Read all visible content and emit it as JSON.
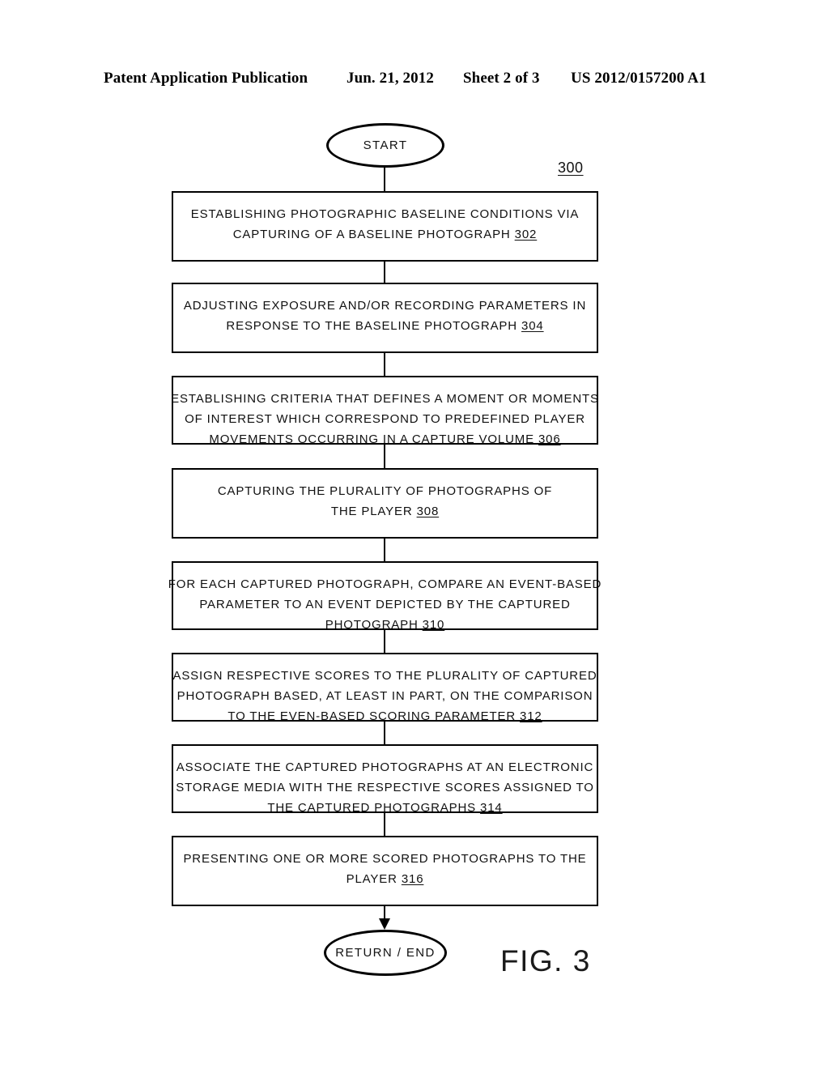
{
  "header": {
    "title": "Patent Application Publication",
    "date": "Jun. 21, 2012",
    "sheet": "Sheet 2 of 3",
    "publication_number": "US 2012/0157200 A1"
  },
  "figure": {
    "caption": "FIG. 3",
    "diagram_reference": "300"
  },
  "flowchart": {
    "start_label": "START",
    "end_label": "RETURN / END",
    "steps": [
      {
        "ref": "302",
        "lines": [
          "ESTABLISHING PHOTOGRAPHIC BASELINE CONDITIONS VIA",
          "CAPTURING OF A BASELINE PHOTOGRAPH"
        ]
      },
      {
        "ref": "304",
        "lines": [
          "ADJUSTING EXPOSURE AND/OR RECORDING PARAMETERS IN",
          "RESPONSE TO THE BASELINE PHOTOGRAPH"
        ]
      },
      {
        "ref": "306",
        "lines": [
          "ESTABLISHING CRITERIA THAT DEFINES A MOMENT OR MOMENTS",
          "OF INTEREST WHICH CORRESPOND TO PREDEFINED PLAYER",
          "MOVEMENTS OCCURRING IN A CAPTURE VOLUME"
        ]
      },
      {
        "ref": "308",
        "lines": [
          "CAPTURING THE PLURALITY OF PHOTOGRAPHS OF",
          "THE PLAYER"
        ]
      },
      {
        "ref": "310",
        "lines": [
          "FOR EACH CAPTURED PHOTOGRAPH, COMPARE AN EVENT-BASED",
          "PARAMETER TO AN EVENT DEPICTED BY THE CAPTURED",
          "PHOTOGRAPH"
        ]
      },
      {
        "ref": "312",
        "lines": [
          "ASSIGN RESPECTIVE SCORES TO THE PLURALITY OF CAPTURED",
          "PHOTOGRAPH BASED, AT LEAST IN PART, ON THE COMPARISON",
          "TO THE EVEN-BASED SCORING PARAMETER"
        ]
      },
      {
        "ref": "314",
        "lines": [
          "ASSOCIATE THE CAPTURED PHOTOGRAPHS AT AN ELECTRONIC",
          "STORAGE MEDIA WITH THE RESPECTIVE SCORES ASSIGNED TO",
          "THE CAPTURED PHOTOGRAPHS"
        ]
      },
      {
        "ref": "316",
        "lines": [
          "PRESENTING ONE OR MORE SCORED PHOTOGRAPHS TO THE",
          "PLAYER"
        ]
      }
    ]
  }
}
